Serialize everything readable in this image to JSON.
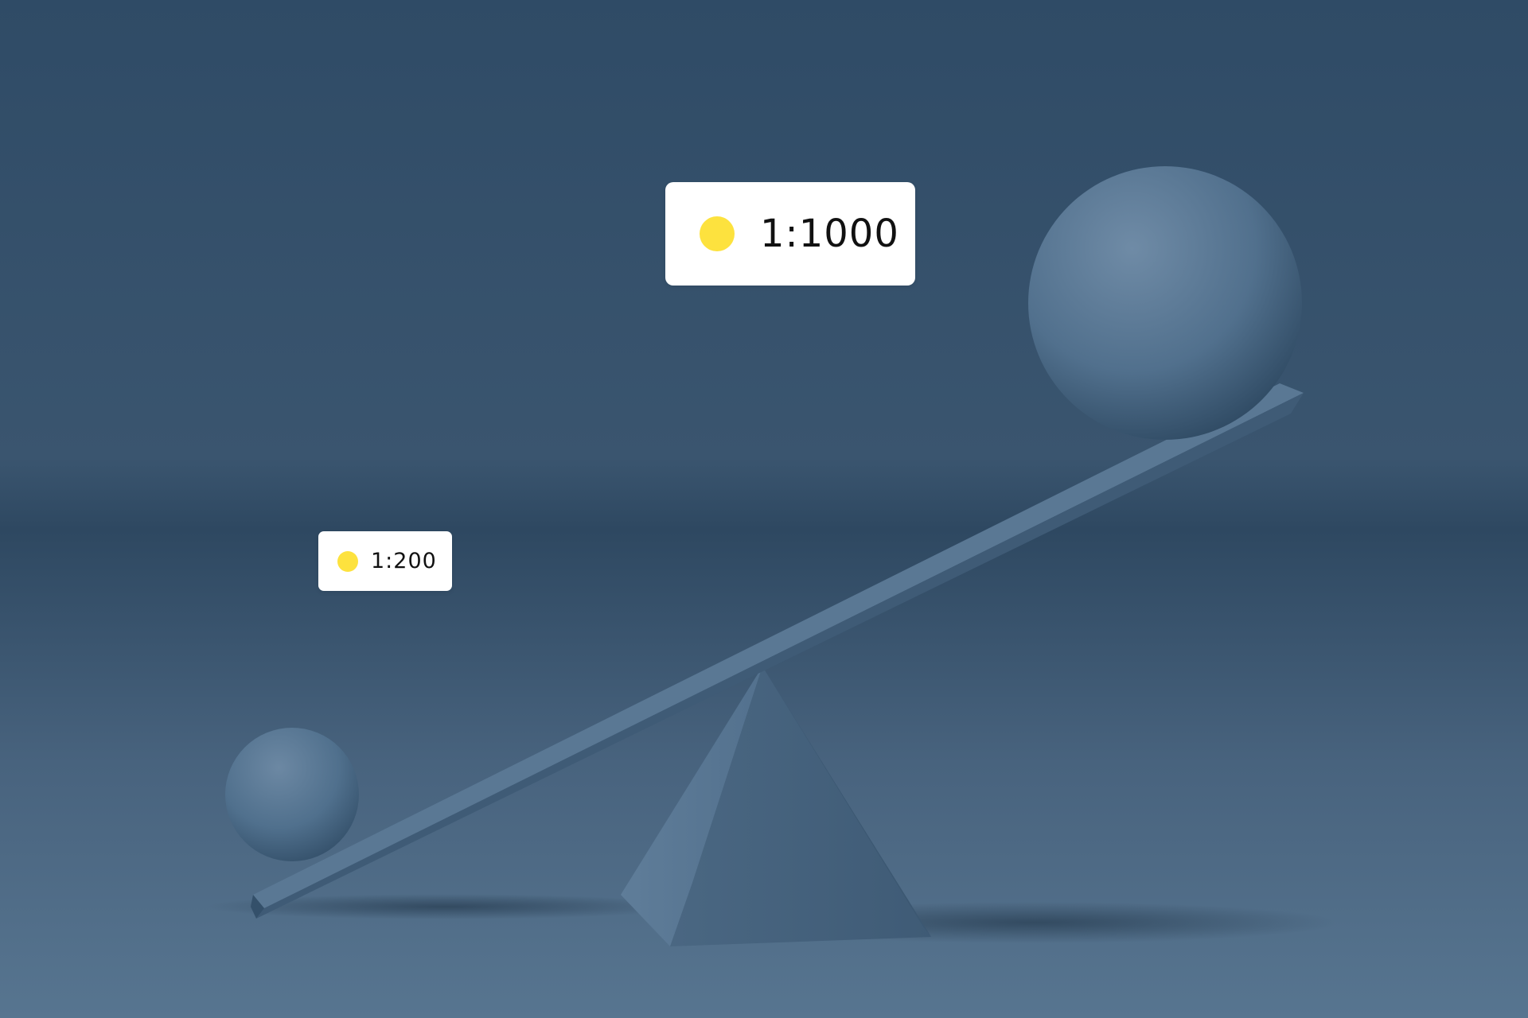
{
  "scene": {
    "background_color": "#3b5670",
    "object_color": "#4f6d89",
    "accent_dot_color": "#fde23e"
  },
  "labels": {
    "large": {
      "text": "1:1000"
    },
    "small": {
      "text": "1:200"
    }
  }
}
